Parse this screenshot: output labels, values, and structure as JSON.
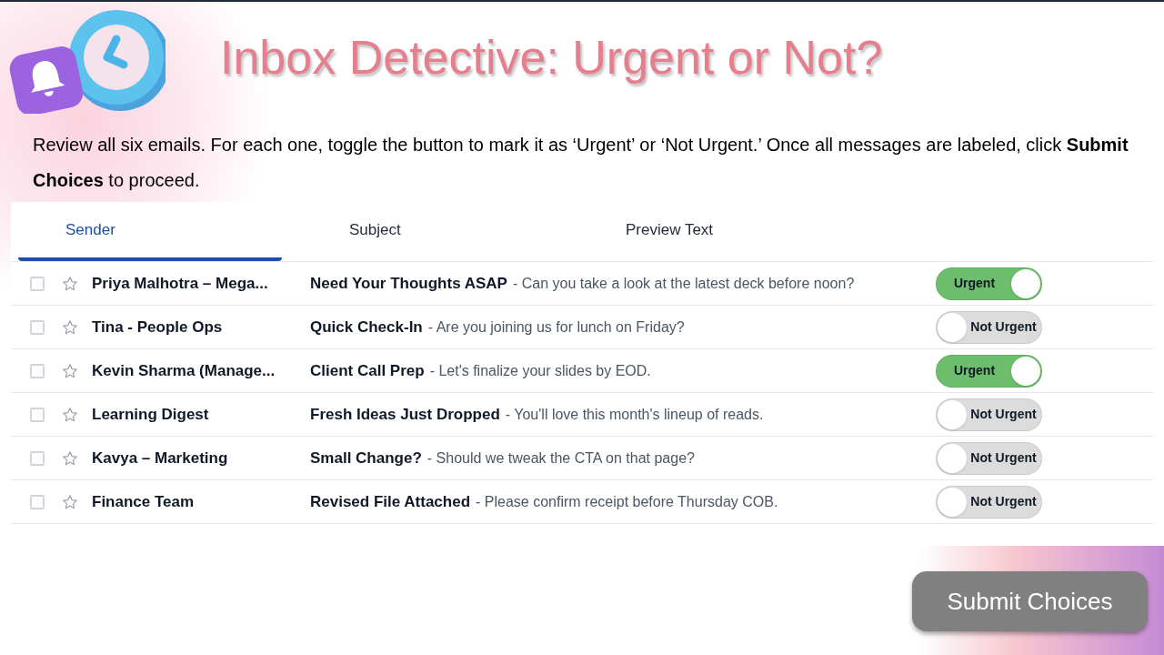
{
  "title": "Inbox Detective: Urgent or Not?",
  "instructions": "Review all six emails. For each one, toggle the button to mark it as ‘Urgent’ or ‘Not Urgent.’ Once all messages are labeled, click **Submit Choices** to proceed.",
  "tabs": [
    {
      "label": "Sender",
      "selected": true
    },
    {
      "label": "Subject",
      "selected": false
    },
    {
      "label": "Preview Text",
      "selected": false
    }
  ],
  "emails": [
    {
      "checked": false,
      "starred": false,
      "sender": "Priya Malhotra – Mega...",
      "subject": "Need Your Thoughts ASAP",
      "preview": "- Can you take a look at the latest deck before noon?",
      "toggle": {
        "on": true,
        "label": "Urgent"
      }
    },
    {
      "checked": false,
      "starred": false,
      "sender": "Tina - People Ops",
      "subject": "Quick Check-In",
      "preview": "- Are you joining us for lunch on Friday?",
      "toggle": {
        "on": false,
        "label": "Not Urgent"
      }
    },
    {
      "checked": false,
      "starred": false,
      "sender": "Kevin Sharma (Manage...",
      "subject": "Client Call Prep",
      "preview": "- Let's finalize your slides by EOD.",
      "toggle": {
        "on": true,
        "label": "Urgent"
      }
    },
    {
      "checked": false,
      "starred": false,
      "sender": "Learning Digest",
      "subject": "Fresh Ideas Just Dropped",
      "preview": "- You'll love this month's lineup of reads.",
      "toggle": {
        "on": false,
        "label": "Not Urgent"
      }
    },
    {
      "checked": false,
      "starred": false,
      "sender": "Kavya – Marketing",
      "subject": "Small Change?",
      "preview": "- Should we tweak the CTA on that page?",
      "toggle": {
        "on": false,
        "label": "Not Urgent"
      }
    },
    {
      "checked": false,
      "starred": false,
      "sender": "Finance Team",
      "subject": "Revised File Attached",
      "preview": "- Please confirm receipt before Thursday COB.",
      "toggle": {
        "on": false,
        "label": "Not Urgent"
      }
    }
  ],
  "submit_button": "Submit Choices"
}
